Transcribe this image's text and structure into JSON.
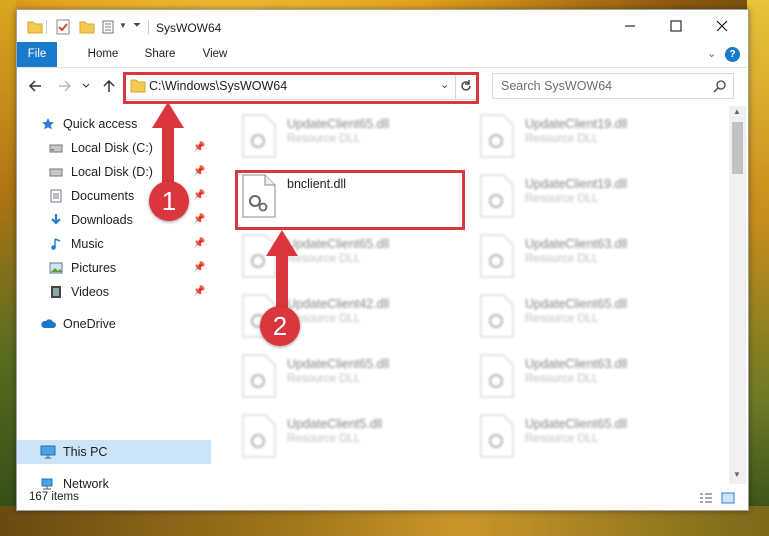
{
  "window": {
    "title": "SysWOW64",
    "controls": {
      "minimize": "—",
      "maximize": "☐",
      "close": "✕"
    }
  },
  "ribbon": {
    "tabs": [
      {
        "label": "File"
      },
      {
        "label": "Home"
      },
      {
        "label": "Share"
      },
      {
        "label": "View"
      }
    ]
  },
  "address": {
    "path": "C:\\Windows\\SysWOW64",
    "search_placeholder": "Search SysWOW64"
  },
  "sidebar": {
    "items": [
      {
        "label": "Quick access",
        "icon": "star-icon"
      },
      {
        "label": "Local Disk (C:)",
        "icon": "drive-icon",
        "pinned": true
      },
      {
        "label": "Local Disk (D:)",
        "icon": "drive-icon",
        "pinned": true
      },
      {
        "label": "Documents",
        "icon": "documents-icon",
        "pinned": true
      },
      {
        "label": "Downloads",
        "icon": "downloads-icon",
        "pinned": true
      },
      {
        "label": "Music",
        "icon": "music-icon",
        "pinned": true
      },
      {
        "label": "Pictures",
        "icon": "pictures-icon",
        "pinned": true
      },
      {
        "label": "Videos",
        "icon": "videos-icon",
        "pinned": true
      },
      {
        "label": "OneDrive",
        "icon": "cloud-icon"
      },
      {
        "label": "This PC",
        "icon": "computer-icon",
        "selected": true
      },
      {
        "label": "Network",
        "icon": "network-icon"
      }
    ]
  },
  "files": {
    "col1": [
      {
        "name": "UpdateClient65.dll",
        "type": "Resource DLL"
      },
      {
        "name": "bnclient.dll",
        "type": ""
      },
      {
        "name": "UpdateClient65.dll",
        "type": "Resource DLL"
      },
      {
        "name": "UpdateClient42.dll",
        "type": "Resource DLL"
      },
      {
        "name": "UpdateClient65.dll",
        "type": "Resource DLL"
      },
      {
        "name": "UpdateClient5.dll",
        "type": "Resource DLL"
      }
    ],
    "col2": [
      {
        "name": "UpdateClient19.dll",
        "type": "Resource DLL"
      },
      {
        "name": "UpdateClient19.dll",
        "type": "Resource DLL"
      },
      {
        "name": "UpdateClient63.dll",
        "type": "Resource DLL"
      },
      {
        "name": "UpdateClient65.dll",
        "type": "Resource DLL"
      },
      {
        "name": "UpdateClient63.dll",
        "type": "Resource DLL"
      },
      {
        "name": "UpdateClient65.dll",
        "type": "Resource DLL"
      }
    ]
  },
  "status": {
    "items": "167 items"
  },
  "annotations": {
    "marker1": "1",
    "marker2": "2"
  },
  "colors": {
    "accent": "#1979ca",
    "annotation": "#d9363e",
    "selection": "#cce4f7"
  }
}
